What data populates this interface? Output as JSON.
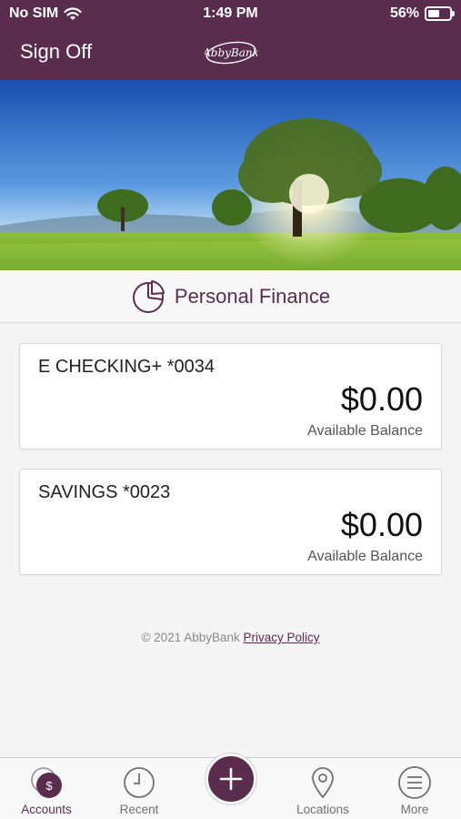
{
  "status_bar": {
    "carrier": "No SIM",
    "time": "1:49 PM",
    "battery_percent": "56%",
    "battery_level": 0.56
  },
  "header": {
    "sign_off_label": "Sign Off",
    "logo_text": "AbbyBank"
  },
  "section": {
    "title": "Personal Finance",
    "icon": "pie-chart-icon"
  },
  "accounts": [
    {
      "name": "E CHECKING+ *0034",
      "amount": "$0.00",
      "balance_label": "Available Balance"
    },
    {
      "name": "SAVINGS *0023",
      "amount": "$0.00",
      "balance_label": "Available Balance"
    }
  ],
  "footer": {
    "copyright": "© 2021 AbbyBank",
    "privacy_link": "Privacy Policy"
  },
  "tabs": [
    {
      "label": "Accounts",
      "icon": "dollar-circle-icon",
      "active": true
    },
    {
      "label": "Recent",
      "icon": "clock-icon",
      "active": false
    },
    {
      "label": "",
      "icon": "plus-icon",
      "active": false
    },
    {
      "label": "Locations",
      "icon": "map-pin-icon",
      "active": false
    },
    {
      "label": "More",
      "icon": "menu-icon",
      "active": false
    }
  ],
  "colors": {
    "brand": "#5a2d4f",
    "background": "#f4f4f4",
    "card": "#ffffff"
  }
}
